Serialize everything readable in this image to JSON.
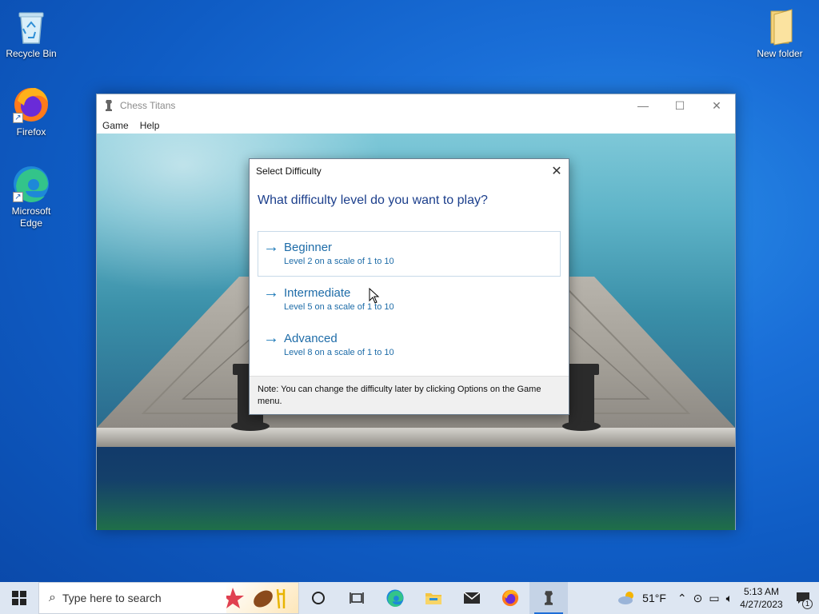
{
  "desktop": {
    "icons": [
      {
        "label": "Recycle Bin"
      },
      {
        "label": "Firefox"
      },
      {
        "label": "Microsoft Edge"
      },
      {
        "label": "New folder"
      }
    ]
  },
  "window": {
    "title": "Chess Titans",
    "controls": {
      "minimize": "—",
      "maximize": "☐",
      "close": "✕"
    },
    "menu": [
      "Game",
      "Help"
    ]
  },
  "dialog": {
    "title": "Select Difficulty",
    "close": "✕",
    "question": "What difficulty level do you want to play?",
    "options": [
      {
        "label": "Beginner",
        "desc": "Level 2 on a scale of 1 to 10",
        "selected": true
      },
      {
        "label": "Intermediate",
        "desc": "Level 5 on a scale of 1 to 10",
        "selected": false
      },
      {
        "label": "Advanced",
        "desc": "Level 8 on a scale of 1 to 10",
        "selected": false
      }
    ],
    "arrow": "→",
    "note": "Note: You can change the difficulty later by clicking Options on the Game menu."
  },
  "taskbar": {
    "search_placeholder": "Type here to search",
    "pinned": [
      "cortana-icon",
      "task-view-icon",
      "edge-icon",
      "file-explorer-icon",
      "mail-icon",
      "firefox-icon",
      "chess-titans-icon"
    ],
    "weather": {
      "temp": "51°F"
    },
    "clock": {
      "time": "5:13 AM",
      "date": "4/27/2023"
    },
    "notifications_count": "1"
  },
  "colors": {
    "accent": "#1e6ca8",
    "desktop_bg": "#0f5cc4",
    "taskbar_bg": "#dde6f2"
  }
}
